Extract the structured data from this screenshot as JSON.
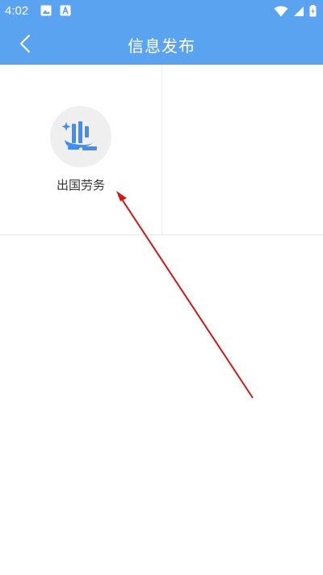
{
  "status_bar": {
    "time": "4:02",
    "left_icons": [
      "image-icon",
      "text-a-icon"
    ],
    "right_icons": [
      "wifi-icon",
      "signal-icon",
      "battery-charging-icon"
    ]
  },
  "nav": {
    "title": "信息发布",
    "back_icon": "chevron-left-icon"
  },
  "grid": {
    "items": [
      {
        "label": "出国劳务",
        "icon": "labor-abroad-icon"
      }
    ]
  },
  "colors": {
    "header_bg": "#5aa3f1",
    "icon_blue": "#3f8ef0",
    "icon_bg": "#efefef",
    "annotation_red": "#d01818"
  }
}
